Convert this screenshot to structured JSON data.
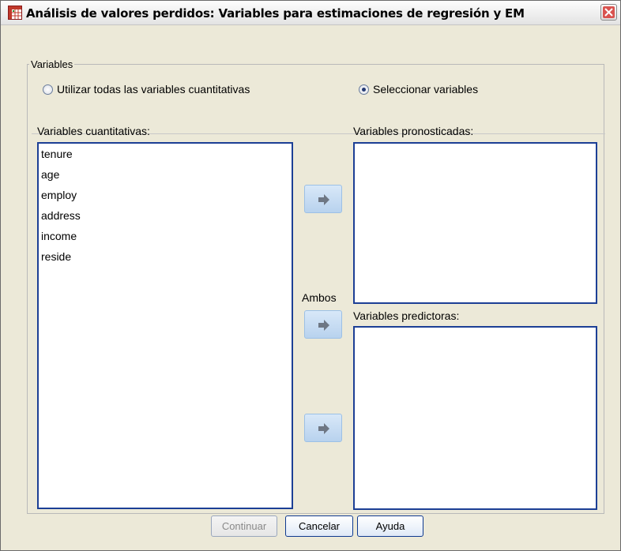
{
  "window": {
    "title": "Análisis de valores perdidos: Variables para estimaciones de regresión y EM",
    "icon": "table-grid-icon"
  },
  "group": {
    "legend": "Variables",
    "radio_all": {
      "label": "Utilizar todas las variables cuantitativas",
      "selected": false
    },
    "radio_select": {
      "label": "Seleccionar variables",
      "selected": true
    }
  },
  "quantitative": {
    "label": "Variables cuantitativas:",
    "items": [
      "tenure",
      "age",
      "employ",
      "address",
      "income",
      "reside"
    ]
  },
  "predicted": {
    "label": "Variables pronosticadas:",
    "items": []
  },
  "predictors": {
    "label": "Variables predictoras:",
    "items": []
  },
  "both_label": "Ambos",
  "buttons": {
    "continue": {
      "label": "Continuar",
      "enabled": false
    },
    "cancel": {
      "label": "Cancelar"
    },
    "help": {
      "label": "Ayuda"
    }
  },
  "colors": {
    "list_border": "#1c3f95",
    "arrow_button": "#c4dbf2",
    "dialog_background": "#ece9d8"
  }
}
